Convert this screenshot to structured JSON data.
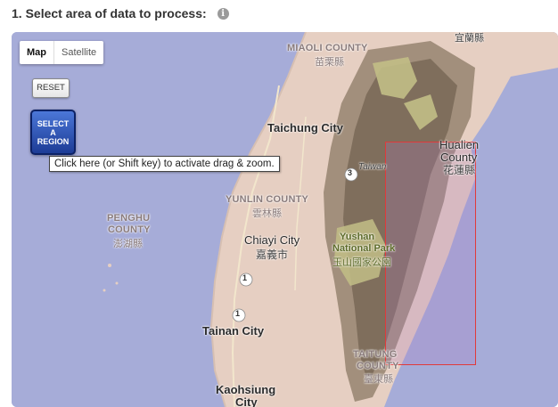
{
  "header": {
    "title": "1. Select area of data to process:",
    "info_icon": "info-icon"
  },
  "map_type": {
    "map_label": "Map",
    "satellite_label": "Satellite",
    "selected": "Map"
  },
  "controls": {
    "reset_label": "RESET",
    "select_region_label": "SELECT A REGION",
    "tooltip": "Click here (or Shift key) to activate drag & zoom."
  },
  "labels": {
    "miaoli_en": "MIAOLI COUNTY",
    "miaoli_zh": "苗栗縣",
    "yilan_zh": "宜蘭縣",
    "taichung": "Taichung City",
    "taiwan": "Taiwan",
    "hualien_en1": "Hualien",
    "hualien_en2": "County",
    "hualien_zh": "花蓮縣",
    "yunlin_en": "YUNLIN COUNTY",
    "yunlin_zh": "雲林縣",
    "penghu_en1": "PENGHU",
    "penghu_en2": "COUNTY",
    "penghu_zh": "澎湖縣",
    "chiayi_en": "Chiayi City",
    "chiayi_zh": "嘉義市",
    "yushan_en1": "Yushan",
    "yushan_en2": "National Park",
    "yushan_zh": "玉山國家公園",
    "tainan": "Tainan City",
    "taitung_en1": "TAITUNG",
    "taitung_en2": "COUNTY",
    "taitung_zh": "臺東縣",
    "kaohsiung1": "Kaohsiung",
    "kaohsiung2": "City",
    "route_1a": "1",
    "route_1b": "1",
    "route_3": "3"
  },
  "colors": {
    "sea": "#a6acd8",
    "land": "#e6cfc2",
    "mountain": "#8f7f6c",
    "park": "#c7c48e",
    "selection_border": "#e03a3a"
  }
}
